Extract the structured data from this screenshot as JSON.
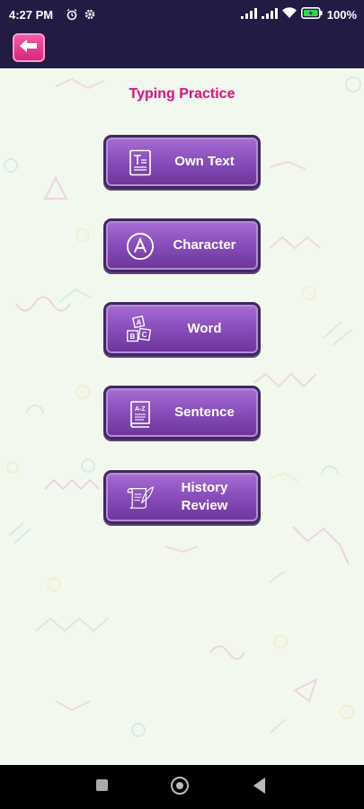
{
  "status_bar": {
    "time": "4:27 PM",
    "battery": "100%"
  },
  "page": {
    "title": "Typing Practice"
  },
  "menu": [
    {
      "label": "Own  Text",
      "icon": "text-document-icon"
    },
    {
      "label": "Character",
      "icon": "circle-a-icon"
    },
    {
      "label": "Word",
      "icon": "abc-blocks-icon"
    },
    {
      "label": "Sentence",
      "icon": "a-z-book-icon"
    },
    {
      "label": "History\nReview",
      "icon": "scroll-quill-icon"
    }
  ],
  "colors": {
    "status_bg": "#221b44",
    "content_bg": "#f3f8ef",
    "button_purple": "#8a4fbd",
    "title_pink": "#c2217e",
    "back_pink": "#e83c93"
  }
}
